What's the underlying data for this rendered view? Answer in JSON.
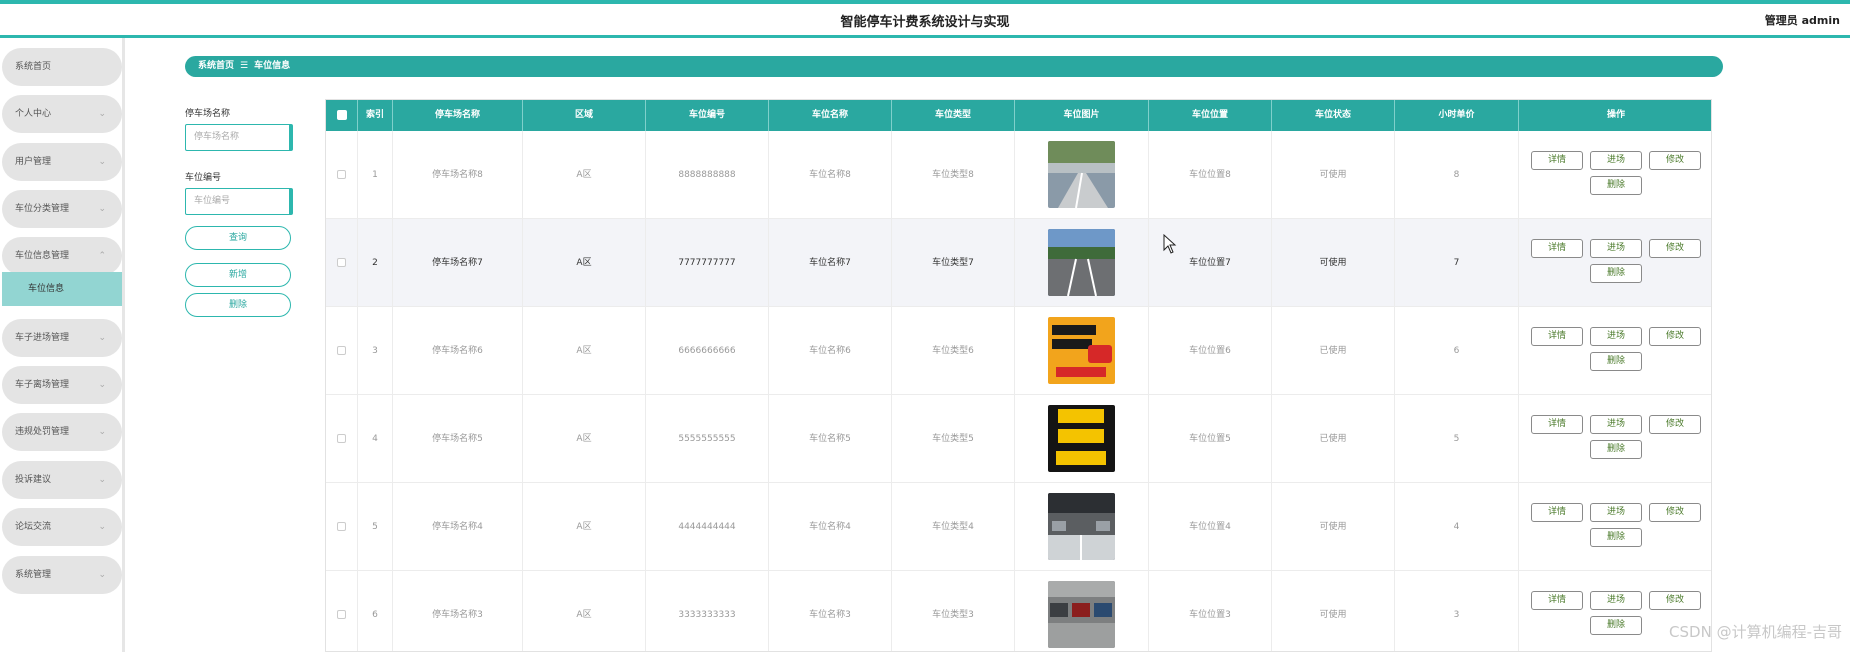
{
  "header": {
    "title": "智能停车计费系统设计与实现",
    "user": "管理员 admin"
  },
  "sidebar": {
    "items": [
      {
        "label": "系统首页",
        "chevron": false
      },
      {
        "label": "个人中心",
        "chevron": true
      },
      {
        "label": "用户管理",
        "chevron": true
      },
      {
        "label": "车位分类管理",
        "chevron": true
      },
      {
        "label": "车位信息管理",
        "chevron": true,
        "expanded": true
      },
      {
        "label": "车子进场管理",
        "chevron": true
      },
      {
        "label": "车子离场管理",
        "chevron": true
      },
      {
        "label": "违规处罚管理",
        "chevron": true
      },
      {
        "label": "投诉建议",
        "chevron": true
      },
      {
        "label": "论坛交流",
        "chevron": true
      },
      {
        "label": "系统管理",
        "chevron": true
      }
    ],
    "submenu": "车位信息"
  },
  "breadcrumb": {
    "home": "系统首页",
    "separator": "☰",
    "current": "车位信息"
  },
  "filters": {
    "lot_name_label": "停车场名称",
    "lot_name_placeholder": "停车场名称",
    "space_no_label": "车位编号",
    "space_no_placeholder": "车位编号",
    "query_btn": "查询",
    "add_btn": "新增",
    "delete_btn": "删除"
  },
  "table": {
    "columns": [
      "索引",
      "停车场名称",
      "区域",
      "车位编号",
      "车位名称",
      "车位类型",
      "车位图片",
      "车位位置",
      "车位状态",
      "小时单价",
      "操作"
    ],
    "op_labels": {
      "detail": "详情",
      "enter": "进场",
      "edit": "修改",
      "delete": "删除"
    },
    "rows": [
      {
        "idx": "1",
        "lot": "停车场名称8",
        "area": "A区",
        "no": "8888888888",
        "name": "车位名称8",
        "type": "车位类型8",
        "pos": "车位位置8",
        "status": "可使用",
        "price": "8"
      },
      {
        "idx": "2",
        "lot": "停车场名称7",
        "area": "A区",
        "no": "7777777777",
        "name": "车位名称7",
        "type": "车位类型7",
        "pos": "车位位置7",
        "status": "可使用",
        "price": "7"
      },
      {
        "idx": "3",
        "lot": "停车场名称6",
        "area": "A区",
        "no": "6666666666",
        "name": "车位名称6",
        "type": "车位类型6",
        "pos": "车位位置6",
        "status": "已使用",
        "price": "6"
      },
      {
        "idx": "4",
        "lot": "停车场名称5",
        "area": "A区",
        "no": "5555555555",
        "name": "车位名称5",
        "type": "车位类型5",
        "pos": "车位位置5",
        "status": "已使用",
        "price": "5"
      },
      {
        "idx": "5",
        "lot": "停车场名称4",
        "area": "A区",
        "no": "4444444444",
        "name": "车位名称4",
        "type": "车位类型4",
        "pos": "车位位置4",
        "status": "可使用",
        "price": "4"
      },
      {
        "idx": "6",
        "lot": "停车场名称3",
        "area": "A区",
        "no": "3333333333",
        "name": "车位名称3",
        "type": "车位类型3",
        "pos": "车位位置3",
        "status": "可使用",
        "price": "3"
      }
    ]
  },
  "watermark": "CSDN @计算机编程-吉哥",
  "colors": {
    "accent": "#2aa8a0",
    "submenu": "#92d5d2"
  }
}
